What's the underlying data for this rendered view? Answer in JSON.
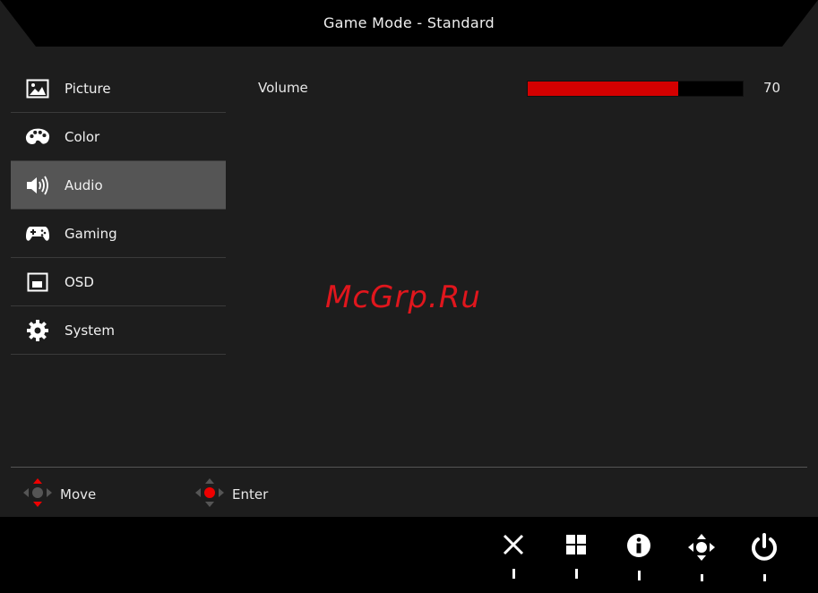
{
  "header": {
    "title": "Game Mode - Standard"
  },
  "sidebar": {
    "items": [
      {
        "label": "Picture",
        "icon": "picture-icon",
        "active": false
      },
      {
        "label": "Color",
        "icon": "palette-icon",
        "active": false
      },
      {
        "label": "Audio",
        "icon": "speaker-icon",
        "active": true
      },
      {
        "label": "Gaming",
        "icon": "gamepad-icon",
        "active": false
      },
      {
        "label": "OSD",
        "icon": "osd-icon",
        "active": false
      },
      {
        "label": "System",
        "icon": "gear-icon",
        "active": false
      }
    ]
  },
  "main": {
    "volume": {
      "label": "Volume",
      "value": "70",
      "level": 0.7
    }
  },
  "watermark": "McGrp.Ru",
  "hints": {
    "move_label": "Move",
    "enter_label": "Enter"
  },
  "keys": [
    {
      "icon": "close-icon"
    },
    {
      "icon": "menu-grid-icon"
    },
    {
      "icon": "info-icon"
    },
    {
      "icon": "navigate-icon"
    },
    {
      "icon": "power-icon"
    }
  ],
  "colors": {
    "accent": "#d40000",
    "active_item_bg": "#555555",
    "background": "#1d1d1d",
    "watermark": "#e0161d"
  }
}
